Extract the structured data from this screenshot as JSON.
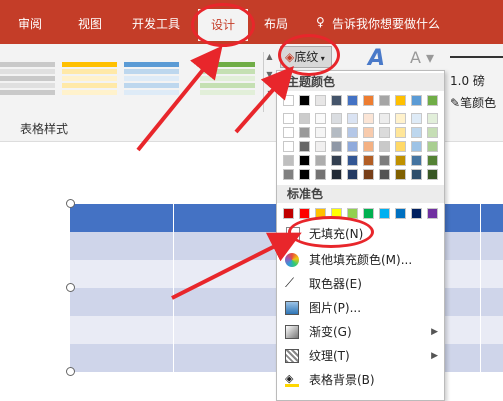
{
  "tabs": {
    "review": "审阅",
    "view": "视图",
    "developer": "开发工具",
    "design": "设计",
    "layout": "布局",
    "tellme": "告诉我你想要做什么"
  },
  "ribbon": {
    "shading": "底纹",
    "group_label": "表格样式",
    "line_weight": "1.0 磅",
    "pen_color": "笔颜色"
  },
  "menu": {
    "theme_colors": "主题颜色",
    "standard_colors": "标准色",
    "no_fill": "无填充(N)",
    "more_colors": "其他填充颜色(M)...",
    "eyedropper": "取色器(E)",
    "picture": "图片(P)...",
    "gradient": "渐变(G)",
    "texture": "纹理(T)",
    "table_background": "表格背景(B)"
  },
  "theme_row": [
    "#ffffff",
    "#000000",
    "#e7e6e6",
    "#44546a",
    "#4472c4",
    "#ed7d31",
    "#a5a5a5",
    "#ffc000",
    "#5b9bd5",
    "#70ad47"
  ],
  "standard_row": [
    "#c00000",
    "#ff0000",
    "#ffc000",
    "#ffff00",
    "#92d050",
    "#00b050",
    "#00b0f0",
    "#0070c0",
    "#002060",
    "#7030a0"
  ],
  "colors": {
    "ribbon": "#c43d28",
    "table_header": "#4472c4",
    "table_band": "#cfd5ea",
    "table_alt": "#e9ebf5",
    "annotation": "#e8262b"
  }
}
